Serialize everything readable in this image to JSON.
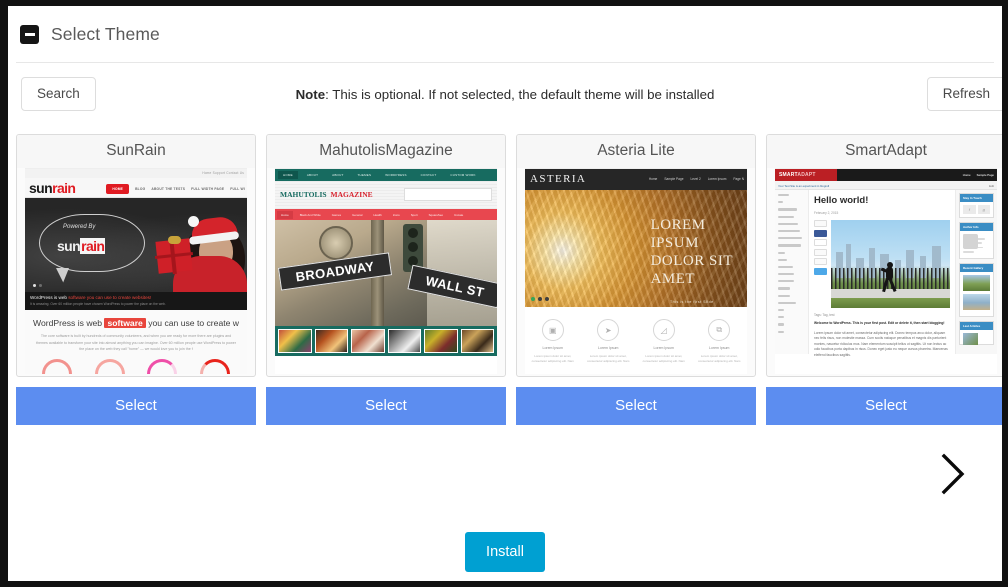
{
  "panel": {
    "title": "Select Theme",
    "collapse_icon": "minus-icon"
  },
  "toolbar": {
    "search_label": "Search",
    "refresh_label": "Refresh",
    "note_prefix": "Note",
    "note_text": ": This is optional. If not selected, the default theme will be installed"
  },
  "themes": [
    {
      "name": "SunRain",
      "select_label": "Select",
      "preview": {
        "logo_a": "sun",
        "logo_b": "rain",
        "toplinks": "Home    Support    Contact Us",
        "nav": [
          "HOME",
          "BLOG",
          "ABOUT THE TESTS",
          "FULL WIDTH PAGE",
          "FULL WI"
        ],
        "hero_script": "Powered By",
        "hero_logo_a": "sun",
        "hero_logo_b": "rain",
        "caption_line1_a": "WordPress is web ",
        "caption_line1_b": "software you can use to create websites!",
        "caption_line2": "It is amazing. Over 60 million people have chosen WordPress to power the place on the web.",
        "heading_a": "WordPress is web ",
        "heading_hi": "software",
        "heading_b": " you can use to create w",
        "paragraph": "The core software is built by hundreds of community volunteers, and when you are ready for more there are plugins and themes available to transform your site into almost anything you can imagine. Over 60 million people use WordPress to power the place on the web they call \"home\" — we would love you to join the f"
      }
    },
    {
      "name": "MahutolisMagazine",
      "select_label": "Select",
      "preview": {
        "nav": [
          "HOME",
          "ABOUT",
          "ABOUT",
          "THEMES",
          "WORDPRESS",
          "CONTACT",
          "CUSTOM WORK"
        ],
        "logo_a": "MAHUTOLIS",
        "logo_b": "MAGAZINE",
        "categories": [
          "Home",
          "Black And White",
          "Games",
          "General",
          "Health",
          "Icons",
          "Sport",
          "SquareSeo",
          "Uncate"
        ],
        "sign_1": "BROADWAY",
        "sign_2": "WALL ST"
      }
    },
    {
      "name": "Asteria Lite",
      "select_label": "Select",
      "preview": {
        "logo": "ASTERIA",
        "nav": [
          "Home",
          "Sample Page",
          "Level 2",
          "Lorem Ipsum",
          "Page N"
        ],
        "hero_lines": [
          "LOREM",
          "IPSUM",
          "DOLOR SIT",
          "AMET"
        ],
        "hero_sub": "This is the first Slide",
        "features": [
          {
            "title": "Lorem Ipsum",
            "text": "Lorem ipsum dolor sit amet, consectetur adipiscing elit. Nam"
          },
          {
            "title": "Lorem Ipsum",
            "text": "Lorem ipsum dolor sit amet, consectetur adipiscing elit. Nam"
          },
          {
            "title": "Lorem Ipsum",
            "text": "Lorem ipsum dolor sit amet, consectetur adipiscing elit. Nam"
          },
          {
            "title": "Lorem Ipsum",
            "text": "Lorem ipsum dolor sit amet, consectetur adipiscing elit. Nam"
          }
        ]
      }
    },
    {
      "name": "SmartAdapt",
      "select_label": "Select",
      "preview": {
        "brand_a": "SMART",
        "brand_b": "ADAPT",
        "nav": [
          "Home",
          "Sample Page"
        ],
        "adminbar_left": "Your Test Site is an experiment in blogroll",
        "adminbar_right": "Edit",
        "post_title": "Hello world!",
        "post_date": "February 2, 2015",
        "post_tags": [
          "Uncategorized",
          "Blogroll"
        ],
        "tagline": "Tags: Tag, test",
        "body_intro": "Welcome to WordPress. This is your first post. Edit or delete it, then start blogging!",
        "body_text": "Lorem ipsum dolor sit amet, consectetur adipiscing elit. Donec tempus arcu dolor, aliquam nec felis risus, non molestie massa. Cum sociis natoque penatibus et magnis dis parturient montes, nascetur ridiculus mus. Nam elementum suscipit tellus ut sagittis. Ut non lectus ac odio faucibus porta dapibus in risus. Donec eget justo eu neque cursus pharetra. Maecenas eleifend faucibus sagittis.",
        "widgets": [
          {
            "title": "Stay In Touch"
          },
          {
            "title": "Author Info"
          },
          {
            "title": "Recent Gallery"
          },
          {
            "title": "Last Articles"
          }
        ]
      }
    }
  ],
  "carousel": {
    "next_icon": "chevron-right-icon"
  },
  "footer": {
    "install_label": "Install"
  },
  "colors": {
    "select_button": "#5c8df0",
    "install_button": "#00a0d2",
    "panel_border": "#e7e7e7"
  }
}
